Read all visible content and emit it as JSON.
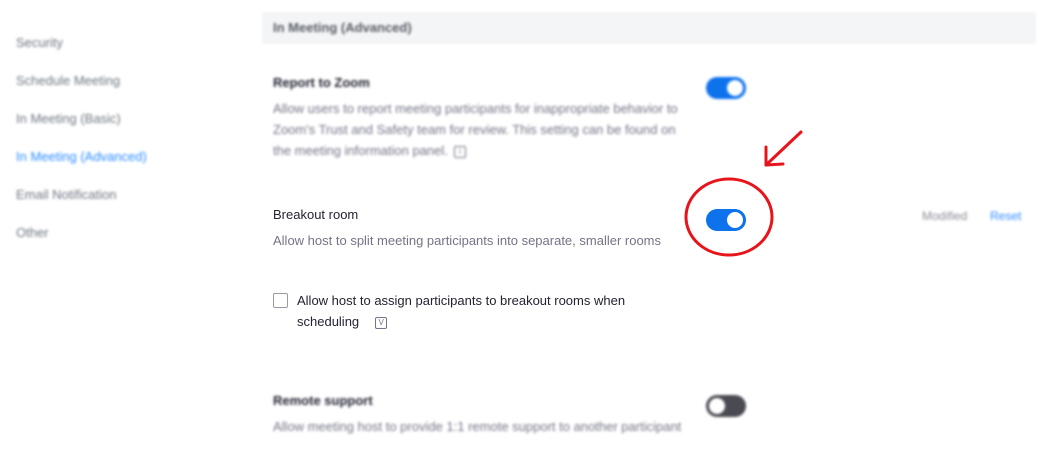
{
  "sidebar": {
    "items": [
      {
        "label": "Security",
        "active": false
      },
      {
        "label": "Schedule Meeting",
        "active": false
      },
      {
        "label": "In Meeting (Basic)",
        "active": false
      },
      {
        "label": "In Meeting (Advanced)",
        "active": true
      },
      {
        "label": "Email Notification",
        "active": false
      },
      {
        "label": "Other",
        "active": false
      }
    ]
  },
  "section": {
    "title": "In Meeting (Advanced)"
  },
  "settings": {
    "report_to_zoom": {
      "title": "Report to Zoom",
      "description": "Allow users to report meeting participants for inappropriate behavior to Zoom's Trust and Safety team for review. This setting can be found on the meeting information panel.",
      "enabled": true
    },
    "breakout_room": {
      "title": "Breakout room",
      "description": "Allow host to split meeting participants into separate, smaller rooms",
      "enabled": true,
      "status": "Modified",
      "reset_label": "Reset",
      "checkbox_label": "Allow host to assign participants to breakout rooms when scheduling",
      "checkbox_checked": false
    },
    "remote_support": {
      "title": "Remote support",
      "description": "Allow meeting host to provide 1:1 remote support to another participant",
      "enabled": false
    }
  },
  "colors": {
    "accent": "#2d8cff",
    "toggle_on": "#0e72ed",
    "toggle_off": "#4a4a52",
    "annotation": "#e8141c"
  }
}
